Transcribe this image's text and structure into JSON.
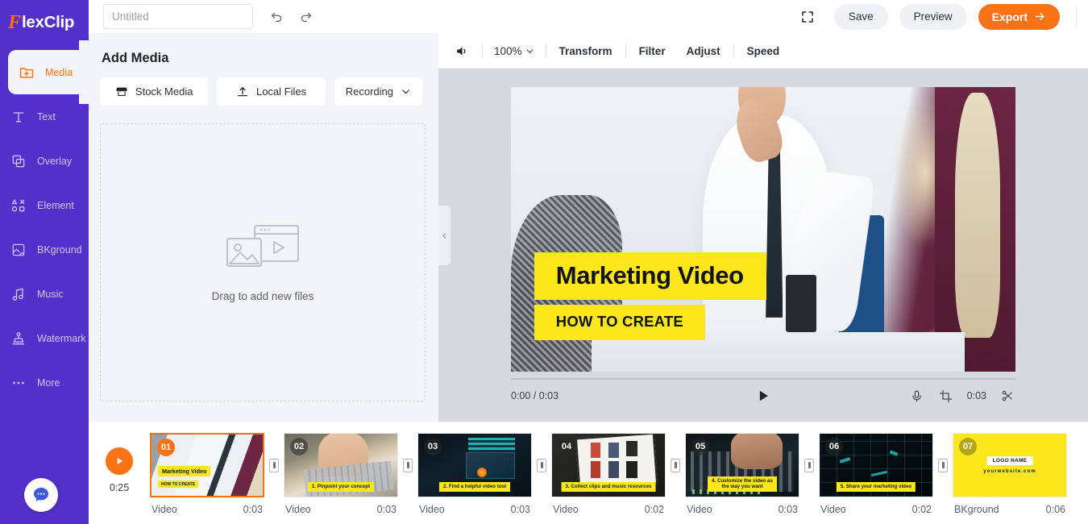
{
  "app": {
    "brand_f": "F",
    "brand_rest": "lexClip",
    "brand_full": "FlexClip"
  },
  "topbar": {
    "title_value": "",
    "title_placeholder": "Untitled",
    "undo_label": "Undo",
    "redo_label": "Redo",
    "fullscreen_label": "Fullscreen",
    "save_label": "Save",
    "preview_label": "Preview",
    "export_label": "Export",
    "export_color": "#f97316"
  },
  "sidebar": {
    "active_color": "#f97316",
    "bg_color": "#5330c9",
    "items": [
      {
        "label": "Media",
        "icon": "media-folder-icon",
        "active": true
      },
      {
        "label": "Text",
        "icon": "text-icon",
        "active": false
      },
      {
        "label": "Overlay",
        "icon": "overlay-icon",
        "active": false
      },
      {
        "label": "Element",
        "icon": "element-icon",
        "active": false
      },
      {
        "label": "BKground",
        "icon": "background-icon",
        "active": false
      },
      {
        "label": "Music",
        "icon": "music-note-icon",
        "active": false
      },
      {
        "label": "Watermark",
        "icon": "watermark-icon",
        "active": false
      },
      {
        "label": "More",
        "icon": "more-dots-icon",
        "active": false
      }
    ],
    "chat_label": "Chat support"
  },
  "media_panel": {
    "title": "Add Media",
    "buttons": [
      {
        "label": "Stock Media",
        "icon": "store-icon",
        "caret": false
      },
      {
        "label": "Local Files",
        "icon": "upload-icon",
        "caret": false
      },
      {
        "label": "Recording",
        "icon": "",
        "caret": true
      }
    ],
    "dropzone_label": "Drag to add new files",
    "dropzone_icon": "media-placeholder-icon"
  },
  "collapse": {
    "icon": "chevron-left-icon"
  },
  "stage": {
    "toolbar": {
      "volume_icon": "speaker-icon",
      "zoom_value": "100%",
      "items": [
        "Transform",
        "Filter",
        "Adjust",
        "Speed"
      ]
    },
    "overlay_title": "Marketing Video",
    "overlay_subtitle": "HOW TO CREATE",
    "overlay_bg": "#fbe71b",
    "player": {
      "time_current": "0:00",
      "time_total": "0:03",
      "time_display": "0:00 / 0:03",
      "play_icon": "play-icon",
      "mic_icon": "microphone-icon",
      "crop_icon": "crop-icon",
      "clip_time": "0:03",
      "scissors_icon": "scissors-icon"
    }
  },
  "timeline": {
    "play_icon": "play-icon",
    "total_duration": "0:25",
    "clips": [
      {
        "number": "01",
        "type": "Video",
        "duration": "0:03",
        "caption": "",
        "selected": true
      },
      {
        "number": "02",
        "type": "Video",
        "duration": "0:03",
        "caption": "1. Pinpoint your concept",
        "selected": false
      },
      {
        "number": "03",
        "type": "Video",
        "duration": "0:03",
        "caption": "2. Find a helpful video tool",
        "selected": false
      },
      {
        "number": "04",
        "type": "Video",
        "duration": "0:02",
        "caption": "3. Collect clips and music resources",
        "selected": false
      },
      {
        "number": "05",
        "type": "Video",
        "duration": "0:03",
        "caption": "4. Customize the video as the way you want",
        "selected": false
      },
      {
        "number": "06",
        "type": "Video",
        "duration": "0:02",
        "caption": "5. Share your marketing video",
        "selected": false
      },
      {
        "number": "07",
        "type": "BKground",
        "duration": "0:06",
        "caption": "",
        "selected": false
      }
    ],
    "clip1_overlay_title": "Marketing Video",
    "clip1_overlay_sub": "HOW TO CREATE",
    "clip7_logo": "LOGO NAME",
    "clip7_site": "yourwebsite.com",
    "separator_icon": "insert-transition-icon"
  }
}
